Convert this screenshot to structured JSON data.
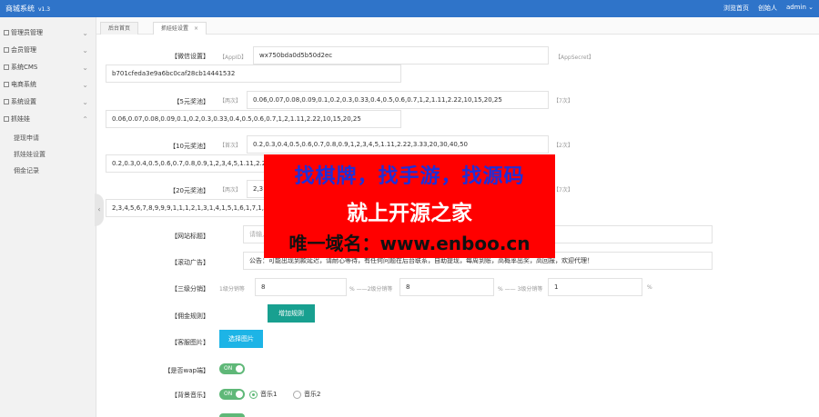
{
  "app": {
    "title": "商城系统",
    "version": "v1.3"
  },
  "topbar": {
    "home_link": "浏览首页",
    "role": "创始人",
    "user": "admin"
  },
  "sidebar": {
    "items": [
      {
        "label": "管理员管理"
      },
      {
        "label": "会员管理"
      },
      {
        "label": "系统CMS"
      },
      {
        "label": "电商系统"
      },
      {
        "label": "系统设置"
      },
      {
        "label": "抓娃娃"
      }
    ],
    "subitems": [
      {
        "label": "提现申请"
      },
      {
        "label": "抓娃娃设置"
      },
      {
        "label": "佣金记录"
      }
    ]
  },
  "tabs": [
    {
      "label": "后台首页"
    },
    {
      "label": "抓娃娃设置",
      "close": "×"
    }
  ],
  "form": {
    "wechat": {
      "label": "【微信设置】",
      "appid_hint": "【AppID】",
      "appid_value": "wx750bda0d5b50d2ec",
      "secret_hint": "【AppSecret】",
      "secret_value": "b701cfeda3e9a6bc0caf28cb14441532"
    },
    "prize5": {
      "label": "【5元奖池】",
      "hint1": "【两次】",
      "value1": "0.06,0.07,0.08,0.09,0.1,0.2,0.3,0.33,0.4,0.5,0.6,0.7,1,2,1.11,2.22,10,15,20,25",
      "hint2": "【7次】",
      "value2": "0.06,0.07,0.08,0.09,0.1,0.2,0.3,0.33,0.4,0.5,0.6,0.7,1,2,1.11,2.22,10,15,20,25"
    },
    "prize10": {
      "label": "【10元奖池】",
      "hint1": "【首次】",
      "value1": "0.2,0.3,0.4,0.5,0.6,0.7,0.8,0.9,1,2,3,4,5,1.11,2.22,3.33,20,30,40,50",
      "hint2": "【2次】",
      "value2": "0.2,0.3,0.4,0.5,0.6,0.7,0.8,0.9,1,2,3,4,5,1.11,2.2"
    },
    "prize20": {
      "label": "【20元奖池】",
      "hint1": "【两次】",
      "value1": "2,3",
      "hint2": "【7次】",
      "value2": "2,3,4,5,6,7,8,9,9,9,1,1,1,2,1,3,1,4,1,5,1,6,1,7,1,8"
    },
    "site_name": {
      "label": "【网站标题】",
      "placeholder": "请输入值"
    },
    "marquee": {
      "label": "【滚动广告】",
      "value": "公告：可能出现到款延迟，请耐心等待，有任何问题在后台联系，自助提现，每周到账，高概率出奖，高回报，欢迎代理！"
    },
    "distribution": {
      "label": "【三级分销】",
      "l1_hint": "1级分销等",
      "l1_value": "8",
      "l2_hint": "% ——2级分销等",
      "l2_value": "8",
      "l3_hint": "% —— 3级分销等",
      "l3_value": "1",
      "pct": "%"
    },
    "commission": {
      "label": "【佣金规则】",
      "button": "增加规则"
    },
    "service_image": {
      "label": "【客服图片】",
      "button": "选择图片"
    },
    "wap": {
      "label": "【是否wap端】",
      "state": "ON"
    },
    "music": {
      "label": "【背景音乐】",
      "state": "ON",
      "opt1": "音乐1",
      "opt2": "音乐2"
    }
  },
  "overlay": {
    "line1": "找棋牌，找手游，找源码",
    "line2": "就上开源之家",
    "line3": "唯一域名：www.enboo.cn"
  },
  "colors": {
    "topbar": "#2f74c9",
    "accent_green": "#18a090",
    "toggle_green": "#5fb878",
    "button_blue": "#1db4e6",
    "overlay_red": "#ff0000"
  }
}
